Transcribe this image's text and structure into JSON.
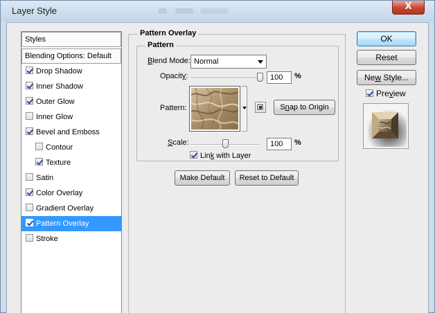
{
  "window": {
    "title": "Layer Style",
    "close_glyph": "X"
  },
  "styles_list": {
    "header": "Styles",
    "blending_options": "Blending Options: Default",
    "items": [
      {
        "label": "Drop Shadow",
        "checked": true,
        "indent": false,
        "selected": false
      },
      {
        "label": "Inner Shadow",
        "checked": true,
        "indent": false,
        "selected": false
      },
      {
        "label": "Outer Glow",
        "checked": true,
        "indent": false,
        "selected": false
      },
      {
        "label": "Inner Glow",
        "checked": false,
        "indent": false,
        "selected": false
      },
      {
        "label": "Bevel and Emboss",
        "checked": true,
        "indent": false,
        "selected": false
      },
      {
        "label": "Contour",
        "checked": false,
        "indent": true,
        "selected": false
      },
      {
        "label": "Texture",
        "checked": true,
        "indent": true,
        "selected": false
      },
      {
        "label": "Satin",
        "checked": false,
        "indent": false,
        "selected": false
      },
      {
        "label": "Color Overlay",
        "checked": true,
        "indent": false,
        "selected": false
      },
      {
        "label": "Gradient Overlay",
        "checked": false,
        "indent": false,
        "selected": false
      },
      {
        "label": "Pattern Overlay",
        "checked": true,
        "indent": false,
        "selected": true
      },
      {
        "label": "Stroke",
        "checked": false,
        "indent": false,
        "selected": false
      }
    ]
  },
  "pattern_overlay": {
    "section_title": "Pattern Overlay",
    "group_title": "Pattern",
    "blend_mode_label_pre": "",
    "blend_mode_label_u": "B",
    "blend_mode_label_post": "lend Mode:",
    "blend_mode_value": "Normal",
    "opacity_label_pre": "Opacit",
    "opacity_label_u": "y",
    "opacity_label_post": ":",
    "opacity_value": "100",
    "opacity_percent": 100,
    "percent_sign": "%",
    "pattern_label": "Pattern:",
    "snap_to_origin_pre": "S",
    "snap_to_origin_u": "n",
    "snap_to_origin_post": "ap to Origin",
    "scale_label_u": "S",
    "scale_label_post": "cale:",
    "scale_value": "100",
    "scale_percent": 100,
    "link_label_pre": "Lin",
    "link_label_u": "k",
    "link_label_post": " with Layer",
    "link_checked": true,
    "make_default": "Make Default",
    "reset_to_default": "Reset to Default"
  },
  "right_panel": {
    "ok": "OK",
    "reset": "Reset",
    "new_style_pre": "Ne",
    "new_style_u": "w",
    "new_style_post": " Style...",
    "preview_pre": "Pre",
    "preview_u": "v",
    "preview_post": "iew",
    "preview_checked": true
  },
  "colors": {
    "selection": "#3399ff",
    "close_button": "#c9452f",
    "title_bar": "#c3d5e9",
    "dialog_bg": "#ececec"
  }
}
